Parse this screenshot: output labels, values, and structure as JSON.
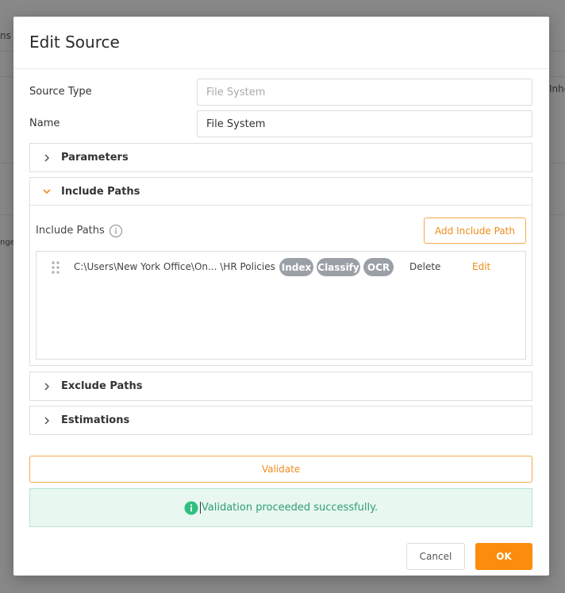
{
  "background": {
    "fragments": [
      "ns",
      "Inhe",
      "nge"
    ]
  },
  "modal": {
    "title": "Edit Source",
    "source_type": {
      "label": "Source Type",
      "placeholder": "File System"
    },
    "name": {
      "label": "Name",
      "value": "File System"
    },
    "panels": {
      "parameters": {
        "label": "Parameters",
        "expanded": false
      },
      "include_paths": {
        "label": "Include Paths",
        "expanded": true,
        "field_label": "Include Paths",
        "add_button": "Add Include Path",
        "rows": [
          {
            "path": "C:\\Users\\New York Office\\On...  \\HR Policies",
            "tags": [
              "Index",
              "Classify",
              "OCR"
            ],
            "delete_label": "Delete",
            "edit_label": "Edit"
          }
        ]
      },
      "exclude_paths": {
        "label": "Exclude Paths",
        "expanded": false
      },
      "estimations": {
        "label": "Estimations",
        "expanded": false
      }
    },
    "validate_button": "Validate",
    "alert": {
      "text": "Validation proceeded successfully."
    },
    "cancel_button": "Cancel",
    "ok_button": "OK"
  },
  "colors": {
    "accent": "#fc8c0c",
    "accent_text": "#f08c1a",
    "tag_bg": "#9aa0a6",
    "success_bg": "#e8f7f0",
    "success_text": "#2f9e72"
  },
  "icons": {
    "collapsed": "chevron-right-icon",
    "expanded": "chevron-down-icon",
    "info": "info-icon",
    "drag": "drag-handle-icon",
    "alert": "info-filled-icon"
  }
}
